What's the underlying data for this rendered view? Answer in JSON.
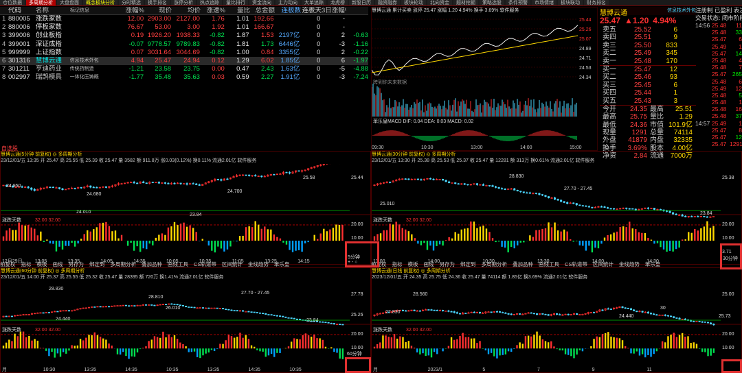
{
  "top_tabs": [
    "仓位数据",
    "多周期分析",
    "大盘盘面",
    "概念板块分析",
    "分时精选",
    "换手排名",
    "涨停分析",
    "热点追踪",
    "量比排行",
    "资金流向",
    "主力动向",
    "大单追踪",
    "龙虎榜",
    "新股日历",
    "融资融券",
    "板块轮动",
    "北向资金",
    "题材挖掘",
    "策略选股",
    "条件预警",
    "市场情绪",
    "板块联动",
    "财务排名"
  ],
  "table": {
    "headers": [
      "",
      "代码",
      "名称",
      "标记信息",
      "涨幅%",
      "现价",
      "均价",
      "涨速%",
      "量比",
      "总金额",
      "连板数",
      "连板天",
      "3日涨幅%"
    ],
    "rows": [
      {
        "n": "1",
        "code": "880005",
        "name": "涨跌家数",
        "info": "",
        "pct": "12.00",
        "price": "2903.00",
        "avg": "2127.00",
        "spd": "1.76",
        "vr": "1.01",
        "amt": "192.66",
        "lb": "0",
        "lbd": "-",
        "d3": ""
      },
      {
        "n": "2",
        "code": "880006",
        "name": "停板家数",
        "info": "",
        "pct": "76.67",
        "price": "53.00",
        "avg": "3.00",
        "spd": "1.92",
        "vr": "1.01",
        "amt": "166.67",
        "lb": "0",
        "lbd": "-",
        "d3": ""
      },
      {
        "n": "3",
        "code": "399006",
        "name": "创业板指",
        "info": "",
        "pct": "0.19",
        "price": "1926.20",
        "avg": "1938.33",
        "spd": "-0.82",
        "vr": "1.87",
        "amt": "1.53",
        "amt2": "2197亿",
        "lb": "0",
        "lbd": "2",
        "d3": "-0.63"
      },
      {
        "n": "4",
        "code": "399001",
        "name": "深证成指",
        "info": "",
        "pct": "-0.07",
        "price": "9778.57",
        "avg": "9789.83",
        "spd": "-0.82",
        "vr": "1.81",
        "amt": "1.73",
        "amt2": "6446亿",
        "lb": "0",
        "lbd": "-3",
        "d3": "-1.16"
      },
      {
        "n": "5",
        "code": "999999",
        "name": "上证指数",
        "info": "",
        "pct": "0.07",
        "price": "3031.64",
        "avg": "3044.69",
        "spd": "-0.82",
        "vr": "1.00",
        "amt": "0.84",
        "amt2": "3355亿",
        "lb": "0",
        "lbd": "2",
        "d3": "-0.22"
      },
      {
        "n": "6",
        "code": "301316",
        "name": "慧博云通",
        "info": "信息技术外包",
        "pct": "4.94",
        "price": "25.47",
        "avg": "24.94",
        "spd": "0.12",
        "vr": "1.29",
        "amt": "6.02",
        "amt2": "1.85亿",
        "lb": "0",
        "lbd": "6",
        "d3": "-1.97"
      },
      {
        "n": "7",
        "code": "301211",
        "name": "亨迪药业",
        "info": "传统药制造",
        "pct": "-1.21",
        "price": "23.58",
        "avg": "23.75",
        "spd": "0.00",
        "vr": "0.47",
        "amt": "2.43",
        "amt2": "1.63亿",
        "lb": "0",
        "lbd": "-5",
        "d3": "-4.88"
      },
      {
        "n": "8",
        "code": "002997",
        "name": "瑞鹄模具",
        "info": "一体化压铸概",
        "pct": "-1.77",
        "price": "35.48",
        "avg": "35.63",
        "spd": "0.03",
        "vr": "0.59",
        "amt": "2.27",
        "amt2": "1.91亿",
        "lb": "0",
        "lbd": "-3",
        "d3": "-7.24"
      }
    ]
  },
  "mini_chart": {
    "header": "慧博云通  累计买卖  涨停 25.47  涨幅 1.20  4.94%  换手 3.69%  软件服务",
    "vol_label": "跨到你未来数据",
    "macd": "苯乐皇MACD  DIF: 0.04  DEA: 0.03  MACD: 0.02",
    "times": [
      "09:30",
      "10:30",
      "13:00",
      "14:00",
      "15:00"
    ],
    "prices": [
      "25.44",
      "25.26",
      "25.07",
      "24.89",
      "24.71",
      "24.53",
      "24.34"
    ],
    "pcts": [
      "4.94%",
      "4.16%",
      "3.40%",
      "2.67%",
      "1.89%",
      "1.14%",
      "0.37%"
    ]
  },
  "quote": {
    "name": "慧博云通",
    "tag": "信息技术外包",
    "price": "25.47",
    "change": "▲1.20",
    "pct": "4.94%",
    "note1": "注册制 已盈利 表决权无差异",
    "note2": "交易状态: 闭市阶段",
    "time": "14:56",
    "time_val": "25.48",
    "sells": [
      [
        "卖五",
        "25.52",
        "6"
      ],
      [
        "卖四",
        "25.51",
        "9"
      ],
      [
        "卖三",
        "25.50",
        "833"
      ],
      [
        "卖二",
        "25.49",
        "345"
      ],
      [
        "卖一",
        "25.48",
        "170"
      ]
    ],
    "buys": [
      [
        "买一",
        "25.47",
        "12"
      ],
      [
        "买二",
        "25.46",
        "93"
      ],
      [
        "买三",
        "25.45",
        "6"
      ],
      [
        "买四",
        "25.44",
        "1"
      ],
      [
        "买五",
        "25.43",
        "3"
      ]
    ],
    "stats": [
      [
        "今开",
        "24.35",
        "最高",
        "25.51"
      ],
      [
        "最高",
        "25.75",
        "量比",
        "1.29"
      ],
      [
        "最低",
        "24.36",
        "市值",
        "101.9亿"
      ],
      [
        "现量",
        "1291",
        "总量",
        "74114"
      ],
      [
        "外盘",
        "41879",
        "内盘",
        "32335"
      ],
      [
        "换手",
        "3.69%",
        "股本",
        "4.00亿"
      ],
      [
        "净资",
        "2.84",
        "流通",
        "7000万"
      ]
    ],
    "ticks": [
      [
        "14:56",
        "25.48",
        "11"
      ],
      [
        "",
        "25.48",
        "33"
      ],
      [
        "",
        "25.47",
        "6"
      ],
      [
        "",
        "25.49",
        "1"
      ],
      [
        "",
        "25.47",
        "14"
      ],
      [
        "",
        "25.48",
        "4"
      ],
      [
        "",
        "25.48",
        "7"
      ],
      [
        "",
        "25.47",
        "265"
      ],
      [
        "",
        "25.48",
        "6"
      ],
      [
        "",
        "25.49",
        "12"
      ],
      [
        "",
        "25.48",
        "5"
      ],
      [
        "",
        "25.48",
        "1"
      ],
      [
        "",
        "25.48",
        "16"
      ],
      [
        "",
        "25.48",
        "37"
      ],
      [
        "14:57",
        "25.49",
        "1"
      ],
      [
        "",
        "25.47",
        "8"
      ],
      [
        "",
        "25.47",
        "12"
      ],
      [
        "",
        "25.47",
        "1291"
      ]
    ]
  },
  "sel_title": "自选股",
  "k1": {
    "title": "慧博云通(5分钟 前复权)  ◎ 多周期分析",
    "info": "23/12/01/五 13:35 开 25.47 高 25.55 低 25.39 收 25.47 量 3582 额 911.8万 涨0.03(0.12%) 换0.11% 流通2.01亿 软件服务",
    "levels": [
      "24.950",
      "24.680",
      "24.700",
      "24.010",
      "23.84",
      "25.58"
    ],
    "axis": "25.44",
    "vol_title": "涨跌天数",
    "vol_vals": "32.00  32.00",
    "axis2": [
      "20.00",
      "10.00"
    ],
    "times": [
      "12月29日",
      "13:05",
      "13:35",
      "14:05",
      "14:35",
      "10:05",
      "10:35",
      "11:05",
      "13:25",
      "14:15"
    ],
    "period": "5分钟",
    "ctrl": "+ - ○"
  },
  "k2": {
    "title": "慧博云通(30分钟 前复权)  ◎ 多周期分析",
    "info": "23/12/01/五 13:30 开 25.38 高 25.53 低 25.37 收 25.47 量 12281 额 313万 换0.61% 流通2.01亿 软件服务",
    "levels": [
      "28.830",
      "27.70 - 27.45",
      "25.010",
      "23.84"
    ],
    "axis": "25.38",
    "vol_title": "涨跌天数",
    "vol_vals": "32.00  32.00",
    "axis2": [
      "20.00",
      "10.00",
      "3.71"
    ],
    "times": [
      "13:00",
      "14:00",
      "10:30",
      "13:30",
      "14:00",
      "14:30"
    ],
    "period": "30分钟"
  },
  "k3": {
    "title": "慧博云通(60分钟 前复权)  ◎ 多周期分析",
    "info": "23/12/01/五 14:00 开 25.37 高 25.55 低 25.32 收 25.47 量 28395 额 720万 换1.41% 流通2.01亿 软件服务",
    "levels": [
      "28.830",
      "28.810",
      "27.70 - 27.45",
      "26.010",
      "24.440",
      "23.84"
    ],
    "axis": [
      "27.78",
      "25.26"
    ],
    "vol_title": "涨跌天数",
    "vol_vals": "32.00  32.00",
    "axis2": [
      "20.00",
      "10.00"
    ],
    "times": [
      "月",
      "10:30",
      "13:35",
      "14:35",
      "10:35",
      "13:35",
      "14:35",
      "10:35"
    ],
    "period": "60分钟"
  },
  "k4": {
    "title": "慧博云通(日线 前复权)  ◎ 多周期分析",
    "info": "2023/12/01/五 开 24.35 高 25.75 低 24.36 收 25.47 量 74114 额 1.85亿 换3.69% 流通2.01亿 软件服务",
    "levels": [
      "28.560",
      "27.830",
      "30",
      "24.440",
      "25.73"
    ],
    "axis": "25.00",
    "vol_title": "涨跌天数",
    "vol_vals": "32.00  32.00",
    "axis2": [
      "20.00",
      "10.00"
    ],
    "times": [
      "月",
      "2023/1",
      "5",
      "7",
      "9",
      "11"
    ]
  },
  "toolbar1": [
    "前复权",
    "指标",
    "模板",
    "画线",
    "另存为",
    "绑定到",
    "多周期分析",
    "叠加品种",
    "画线工具",
    "CS轨道带",
    "区间统计",
    "金线趋势",
    "苯乐皇"
  ],
  "toolbar2": [
    "前复权",
    "指标",
    "模板",
    "画线",
    "另存为",
    "绑定到",
    "多周期分析",
    "叠加品种",
    "画线工具",
    "CS轨道带",
    "区间统计",
    "金线趋势",
    "苯乐皇"
  ],
  "colors": {
    "up": "#ff3030",
    "down": "#00e0e0",
    "frame": "#5a0000",
    "bg": "#000000"
  }
}
